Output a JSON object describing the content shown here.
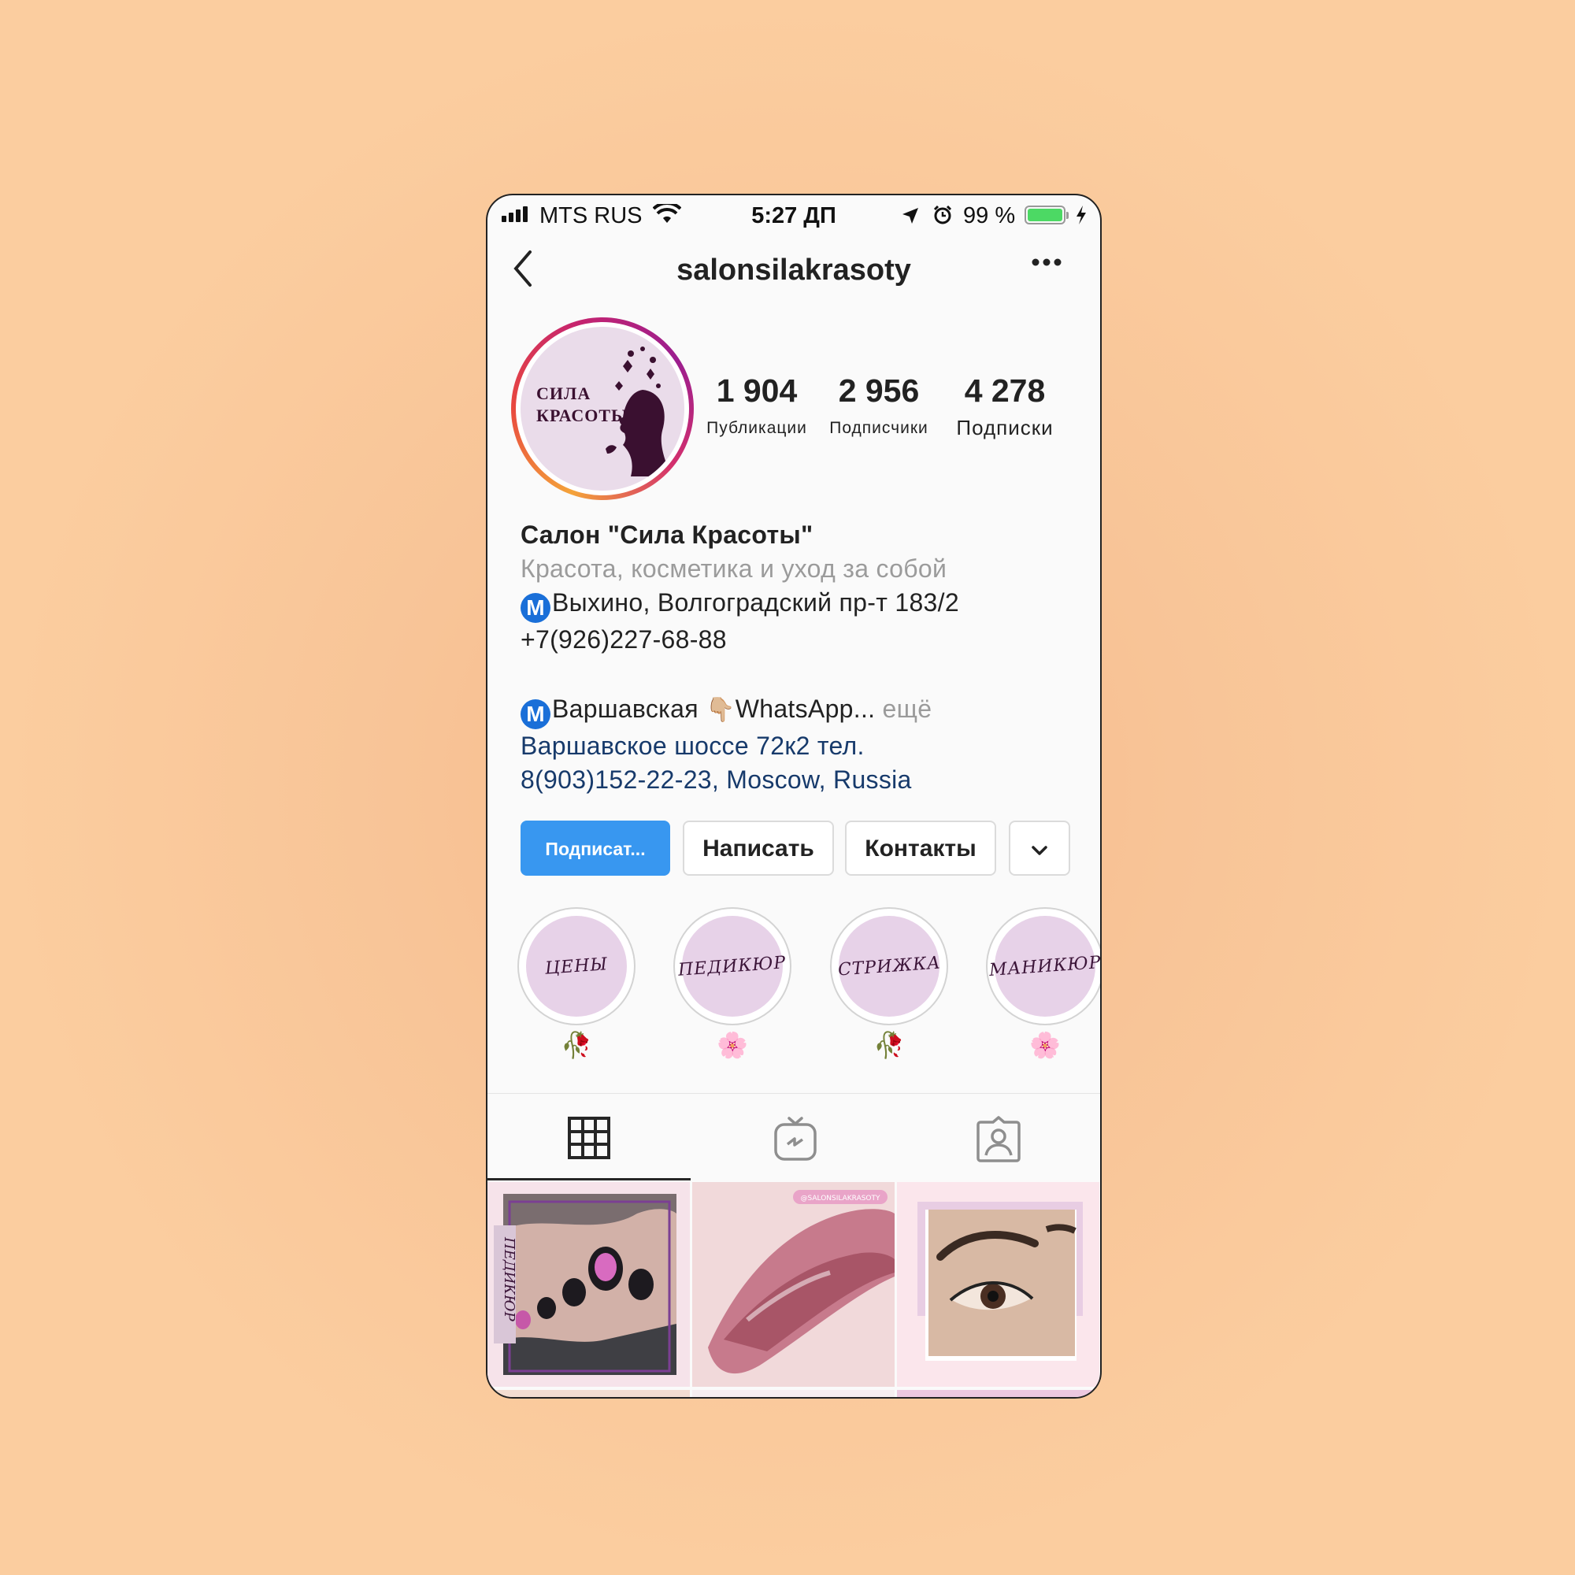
{
  "status_bar": {
    "carrier": "MTS RUS",
    "time": "5:27 ДП",
    "battery_percent": "99 %"
  },
  "header": {
    "username": "salonsilakrasoty"
  },
  "avatar": {
    "logo_line1": "СИЛА",
    "logo_line2": "КРАСОТЫ"
  },
  "stats": [
    {
      "value": "1 904",
      "label": "Публикации"
    },
    {
      "value": "2 956",
      "label": "Подписчики"
    },
    {
      "value": "4 278",
      "label": "Подписки"
    }
  ],
  "bio": {
    "name": "Салон \"Сила Красоты\"",
    "category": "Красота, косметика и уход за собой",
    "metro_symbol": "M",
    "address1": "Выхино, Волгоградский пр-т 183/2",
    "phone1": "+7(926)227-68-88",
    "address2": "Варшавская",
    "whatsapp": "WhatsApp...",
    "more": "ещё",
    "location_line1": "Варшавское шоссе 72к2 тел.",
    "location_line2": "8(903)152-22-23, Moscow, Russia"
  },
  "actions": {
    "follow": "Подписат...",
    "message": "Написать",
    "contacts": "Контакты"
  },
  "highlights": [
    {
      "cover_text": "ЦЕНЫ",
      "label": "🥀"
    },
    {
      "cover_text": "ПЕДИКЮР",
      "label": "🌸"
    },
    {
      "cover_text": "СТРИЖКА",
      "label": "🥀"
    },
    {
      "cover_text": "МАНИКЮР",
      "label": "🌸"
    }
  ],
  "posts": [
    {
      "overlay_text": "ПЕДИКЮР"
    },
    {
      "overlay_text": "@SALONSILAKRASOTY"
    },
    {
      "overlay_text": ""
    }
  ],
  "colors": {
    "background": "#fbcb9b",
    "follow_button": "#3897f0",
    "location_link": "#173a6b",
    "highlight_cover": "#e7d2e8"
  }
}
